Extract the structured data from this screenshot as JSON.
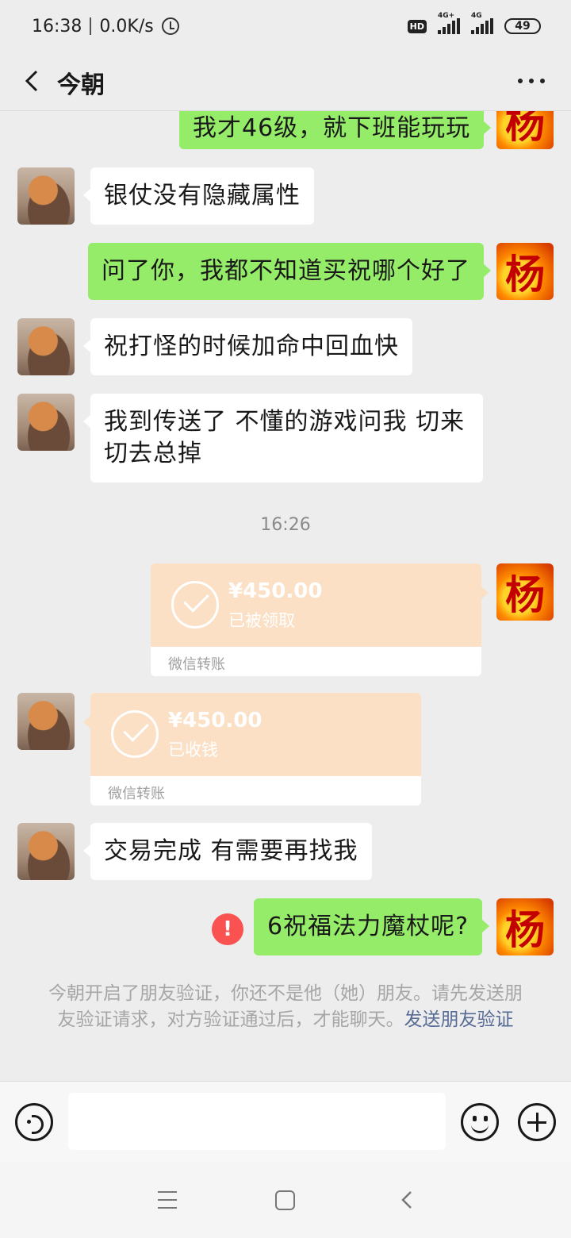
{
  "status_bar": {
    "time": "16:38",
    "speed": "0.0K/s",
    "hd": "HD",
    "signal1": "4G+",
    "signal2": "4G",
    "battery": "49"
  },
  "header": {
    "title": "今朝"
  },
  "messages": [
    {
      "side": "right",
      "text": "我才46级，就下班能玩玩"
    },
    {
      "side": "left",
      "text": "银仗没有隐藏属性"
    },
    {
      "side": "right",
      "text": "问了你，我都不知道买祝哪个好了"
    },
    {
      "side": "left",
      "text": "祝打怪的时候加命中回血快"
    },
    {
      "side": "left",
      "text": "我到传送了 不懂的游戏问我 切来切去总掉"
    },
    {
      "time": "16:26"
    },
    {
      "side": "right",
      "type": "transfer",
      "amount": "¥450.00",
      "status": "已被领取",
      "footer": "微信转账"
    },
    {
      "side": "left",
      "type": "transfer",
      "amount": "¥450.00",
      "status": "已收钱",
      "footer": "微信转账"
    },
    {
      "side": "left",
      "text": "交易完成 有需要再找我"
    },
    {
      "side": "right",
      "text": "6祝福法力魔杖呢?",
      "error": "!"
    }
  ],
  "system_note": {
    "text": "今朝开启了朋友验证，你还不是他（她）朋友。请先发送朋友验证请求，对方验证通过后，才能聊天。",
    "link": "发送朋友验证"
  },
  "avatars": {
    "self_char": "杨"
  }
}
